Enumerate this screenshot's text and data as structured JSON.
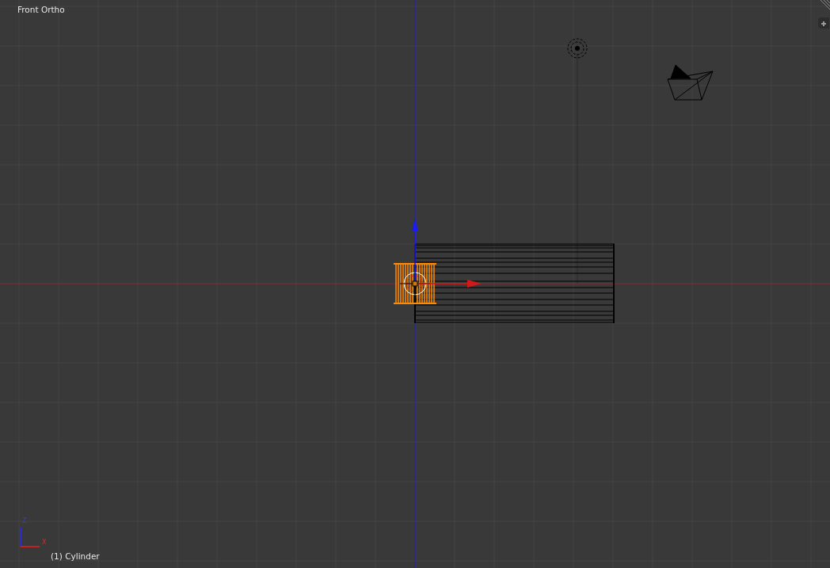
{
  "viewport": {
    "view_label": "Front Ortho",
    "object_label": "(1) Cylinder"
  },
  "axis_gizmo": {
    "z_label": "Z",
    "x_label": "X"
  },
  "objects": [
    {
      "kind": "lamp",
      "selected": false
    },
    {
      "kind": "camera",
      "selected": false
    },
    {
      "kind": "cylinder-long",
      "selected": false
    },
    {
      "kind": "cylinder-short",
      "selected": true
    }
  ]
}
